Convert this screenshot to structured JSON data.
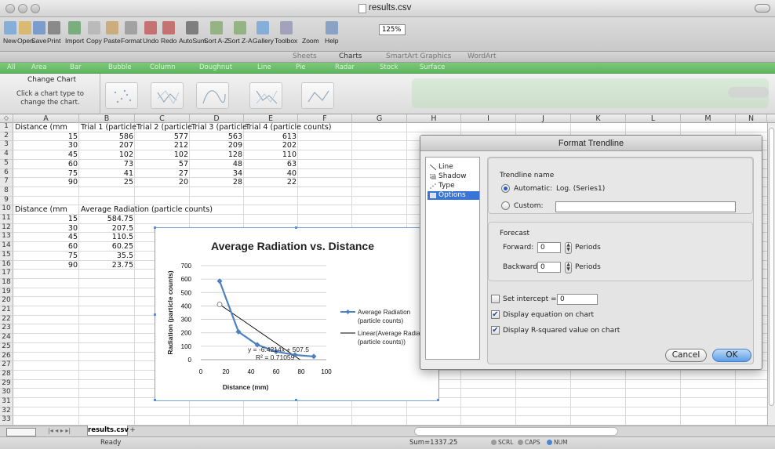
{
  "window": {
    "title": "results.csv"
  },
  "toolbar": {
    "items": [
      "New",
      "Open",
      "Save",
      "Print",
      "Import",
      "Copy",
      "Paste",
      "Format",
      "Undo",
      "Redo",
      "AutoSum",
      "Sort A-Z",
      "Sort Z-A",
      "Gallery",
      "Toolbox",
      "Zoom",
      "Help"
    ],
    "zoom_value": "125%"
  },
  "ribbon_tabs": [
    "Sheets",
    "Charts",
    "SmartArt Graphics",
    "WordArt"
  ],
  "gallery_tabs": [
    "All",
    "Area",
    "Bar",
    "Bubble",
    "Column",
    "Doughnut",
    "Line",
    "Pie",
    "Radar",
    "Stock",
    "Surface"
  ],
  "change_chart": {
    "title": "Change Chart",
    "hint": "Click a chart type to change the chart."
  },
  "columns": [
    "A",
    "B",
    "C",
    "D",
    "E",
    "F",
    "G",
    "H",
    "I",
    "J",
    "K",
    "L",
    "M",
    "N"
  ],
  "rows": [
    "1",
    "2",
    "3",
    "4",
    "5",
    "6",
    "7",
    "8",
    "9",
    "10",
    "11",
    "12",
    "13",
    "14",
    "15",
    "16",
    "17",
    "18",
    "19",
    "20",
    "21",
    "22",
    "23",
    "24",
    "25",
    "26",
    "27",
    "28",
    "29",
    "30",
    "31",
    "32",
    "33"
  ],
  "cells": {
    "r1": [
      "Distance (mm",
      "Trial 1 (particle",
      "Trial 2 (particle",
      "Trial 3 (particle",
      "Trial 4 (particle counts)"
    ],
    "r2": [
      "15",
      "586",
      "577",
      "563",
      "613"
    ],
    "r3": [
      "30",
      "207",
      "212",
      "209",
      "202"
    ],
    "r4": [
      "45",
      "102",
      "102",
      "128",
      "110"
    ],
    "r5": [
      "60",
      "73",
      "57",
      "48",
      "63"
    ],
    "r6": [
      "75",
      "41",
      "27",
      "34",
      "40"
    ],
    "r7": [
      "90",
      "25",
      "20",
      "28",
      "22"
    ],
    "r10": [
      "Distance (mm",
      "Average Radiation (particle counts)"
    ],
    "r11": [
      "15",
      "584.75"
    ],
    "r12": [
      "30",
      "207.5"
    ],
    "r13": [
      "45",
      "110.5"
    ],
    "r14": [
      "60",
      "60.25"
    ],
    "r15": [
      "75",
      "35.5"
    ],
    "r16": [
      "90",
      "23.75"
    ]
  },
  "chart_data": {
    "type": "scatter",
    "title": "Average Radiation vs. Distance",
    "xlabel": "Distance (mm)",
    "ylabel": "Radiation (particle counts)",
    "xlim": [
      0,
      100
    ],
    "ylim": [
      0,
      700
    ],
    "xticks": [
      "0",
      "20",
      "40",
      "60",
      "80",
      "100"
    ],
    "yticks": [
      "0",
      "100",
      "200",
      "300",
      "400",
      "500",
      "600",
      "700"
    ],
    "legend": [
      "Average Radiation (particle counts)",
      "Linear(Average Radia (particle counts))"
    ],
    "equation": "y = -6.4214x + 507.5",
    "r_squared": "R² = 0.71059",
    "series": [
      {
        "name": "Average Radiation (particle counts)",
        "x": [
          15,
          30,
          45,
          60,
          75,
          90
        ],
        "y": [
          584.75,
          207.5,
          110.5,
          60.25,
          35.5,
          23.75
        ],
        "color": "#4f81bd"
      },
      {
        "name": "Linear(Average Radia (particle counts))",
        "x": [
          15,
          90
        ],
        "y": [
          411.2,
          -70.4
        ],
        "color": "#000000"
      }
    ]
  },
  "dialog": {
    "title": "Format Trendline",
    "sidebar": [
      "Line",
      "Shadow",
      "Type",
      "Options"
    ],
    "selected": "Options",
    "trendline_name_label": "Trendline name",
    "automatic_label": "Automatic:",
    "automatic_value": "Log. (Series1)",
    "custom_label": "Custom:",
    "forecast_label": "Forecast",
    "forward_label": "Forward:",
    "forward_value": "0",
    "backward_label": "Backward:",
    "backward_value": "0",
    "periods": "Periods",
    "intercept_label": "Set intercept =",
    "intercept_value": "0",
    "display_equation": "Display equation on chart",
    "display_r2": "Display R-squared value on chart",
    "cancel": "Cancel",
    "ok": "OK"
  },
  "sheet": {
    "tab": "results.csv",
    "add": "+"
  },
  "status": {
    "state": "Ready",
    "sum": "Sum=1337.25",
    "scrl": "SCRL",
    "caps": "CAPS",
    "num": "NUM"
  }
}
